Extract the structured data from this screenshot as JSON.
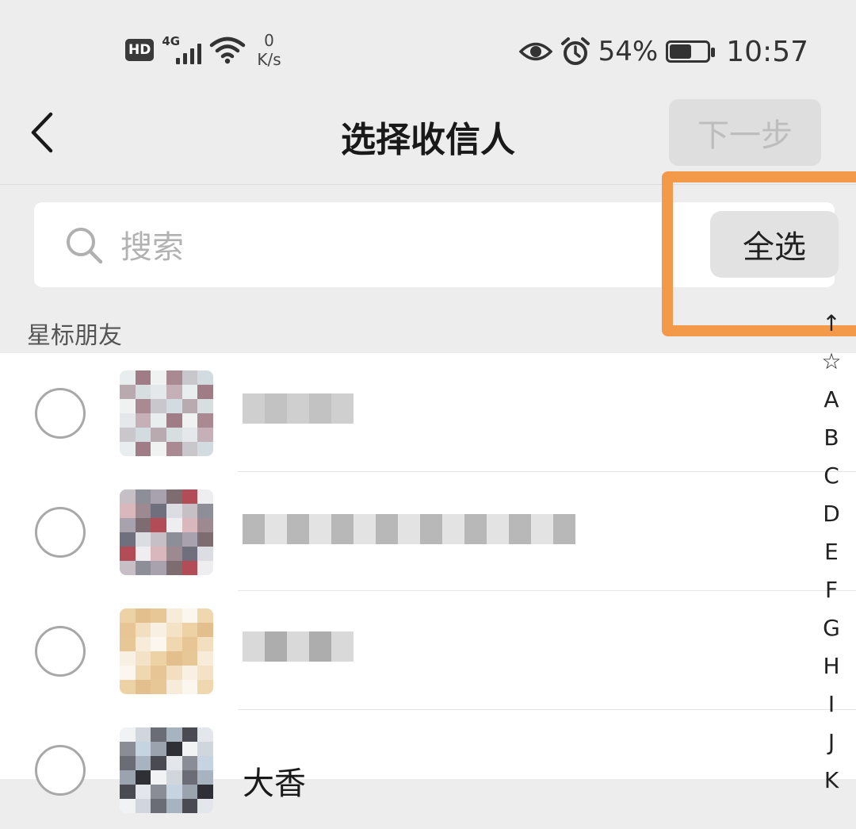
{
  "status_bar": {
    "hd": "HD",
    "network": "4G",
    "speed_value": "0",
    "speed_unit": "K/s",
    "battery_percent": "54%",
    "battery_level": 0.54,
    "time": "10:57",
    "icons": [
      "hd-icon",
      "signal-icon",
      "wifi-icon",
      "eye-icon",
      "alarm-icon",
      "battery-icon"
    ]
  },
  "nav": {
    "back_icon": "chevron-left-icon",
    "title": "选择收信人",
    "next_label": "下一步"
  },
  "search": {
    "icon": "search-icon",
    "placeholder": "搜索",
    "value": ""
  },
  "select_all_label": "全选",
  "highlight_color": "#f29a4a",
  "section_title": "星标朋友",
  "contacts": [
    {
      "name": "",
      "selected": false
    },
    {
      "name": "",
      "selected": false
    },
    {
      "name": "",
      "selected": false
    },
    {
      "name": "大香",
      "selected": false
    }
  ],
  "index_letters": [
    "↑",
    "☆",
    "A",
    "B",
    "C",
    "D",
    "E",
    "F",
    "G",
    "H",
    "I",
    "J",
    "K"
  ]
}
